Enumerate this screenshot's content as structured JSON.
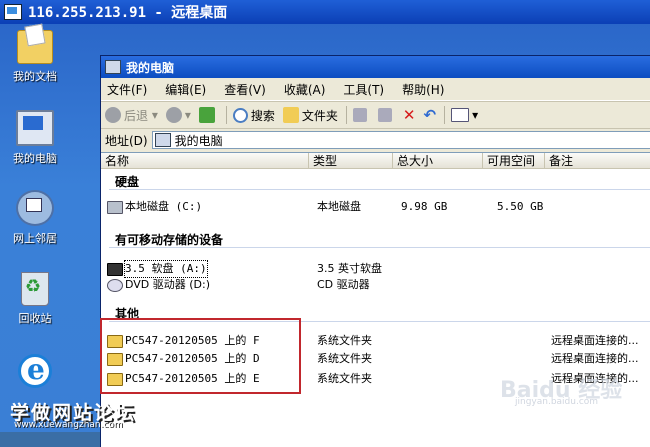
{
  "rdp": {
    "title": "116.255.213.91 - 远程桌面"
  },
  "desktop": {
    "icons": [
      {
        "label": "我的文档",
        "icon": "documents-folder-icon"
      },
      {
        "label": "我的电脑",
        "icon": "my-computer-icon"
      },
      {
        "label": "网上邻居",
        "icon": "network-places-icon"
      },
      {
        "label": "回收站",
        "icon": "recycle-bin-icon"
      },
      {
        "label": "",
        "icon": "internet-explorer-icon"
      }
    ]
  },
  "window": {
    "title": "我的电脑",
    "menu": [
      "文件(F)",
      "编辑(E)",
      "查看(V)",
      "收藏(A)",
      "工具(T)",
      "帮助(H)"
    ],
    "toolbar": {
      "back": "后退",
      "search": "搜索",
      "folders": "文件夹"
    },
    "address": {
      "label": "地址(D)",
      "value": "我的电脑"
    },
    "columns": [
      "名称",
      "类型",
      "总大小",
      "可用空间",
      "备注"
    ],
    "groups": [
      {
        "title": "硬盘",
        "items": [
          {
            "name": "本地磁盘 (C:)",
            "type": "本地磁盘",
            "total": "9.98 GB",
            "free": "5.50 GB",
            "note": ""
          }
        ]
      },
      {
        "title": "有可移动存储的设备",
        "items": [
          {
            "name": "3.5 软盘 (A:)",
            "type": "3.5 英寸软盘",
            "total": "",
            "free": "",
            "note": ""
          },
          {
            "name": "DVD 驱动器 (D:)",
            "type": "CD 驱动器",
            "total": "",
            "free": "",
            "note": ""
          }
        ]
      },
      {
        "title": "其他",
        "items": [
          {
            "name": "PC547-20120505 上的 F",
            "type": "系统文件夹",
            "total": "",
            "free": "",
            "note": "远程桌面连接的..."
          },
          {
            "name": "PC547-20120505 上的 D",
            "type": "系统文件夹",
            "total": "",
            "free": "",
            "note": "远程桌面连接的..."
          },
          {
            "name": "PC547-20120505 上的 E",
            "type": "系统文件夹",
            "total": "",
            "free": "",
            "note": "远程桌面连接的..."
          }
        ]
      }
    ]
  },
  "watermarks": {
    "site": "学做网站论坛",
    "site_url": "www.xuewangzhan.com",
    "baidu": "Baidu 经验",
    "baidu_url": "jingyan.baidu.com"
  },
  "colors": {
    "highlight": "#c1272d",
    "titlebar": "#0c4dc1",
    "desktop": "#3a7fd5"
  }
}
